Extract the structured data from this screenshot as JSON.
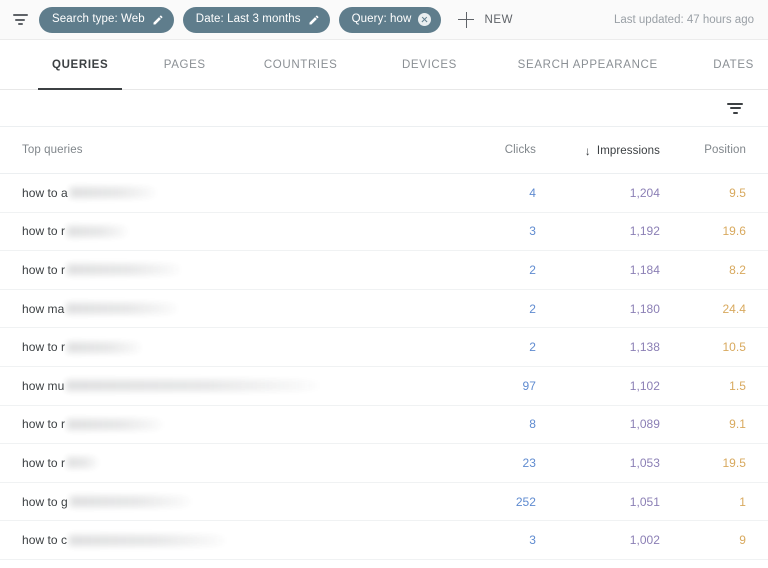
{
  "filter_bar": {
    "filter_icon": "filter-icon",
    "chips": [
      {
        "label": "Search type: Web",
        "action": "edit",
        "action_icon": "pencil-icon"
      },
      {
        "label": "Date: Last 3 months",
        "action": "edit",
        "action_icon": "pencil-icon"
      },
      {
        "label": "Query: how",
        "action": "clear",
        "action_icon": "close-circle-icon"
      }
    ],
    "new_button": {
      "label": "NEW",
      "icon": "plus-icon"
    },
    "last_updated": "Last updated: 47 hours ago",
    "chip_color": "#5f7d8c"
  },
  "tabs": [
    {
      "label": "QUERIES",
      "active": true
    },
    {
      "label": "PAGES",
      "active": false
    },
    {
      "label": "COUNTRIES",
      "active": false
    },
    {
      "label": "DEVICES",
      "active": false
    },
    {
      "label": "SEARCH APPEARANCE",
      "active": false
    },
    {
      "label": "DATES",
      "active": false
    }
  ],
  "table_toolbar": {
    "filter_icon": "filter-icon"
  },
  "table": {
    "columns": {
      "query": "Top queries",
      "clicks": "Clicks",
      "impressions": "Impressions",
      "position": "Position"
    },
    "sort": {
      "column": "Impressions",
      "direction": "descending",
      "arrow": "↓"
    },
    "value_colors": {
      "clicks": "#5f8bd0",
      "impressions": "#8b7fb5",
      "position": "#d8a95e"
    },
    "rows": [
      {
        "query_prefix": "how to a",
        "redacted_width": 88,
        "clicks": "4",
        "impressions": "1,204",
        "position": "9.5"
      },
      {
        "query_prefix": "how to r",
        "redacted_width": 62,
        "clicks": "3",
        "impressions": "1,192",
        "position": "19.6"
      },
      {
        "query_prefix": "how to r",
        "redacted_width": 116,
        "clicks": "2",
        "impressions": "1,184",
        "position": "8.2"
      },
      {
        "query_prefix": "how ma",
        "redacted_width": 114,
        "clicks": "2",
        "impressions": "1,180",
        "position": "24.4"
      },
      {
        "query_prefix": "how to r",
        "redacted_width": 76,
        "clicks": "2",
        "impressions": "1,138",
        "position": "10.5"
      },
      {
        "query_prefix": "how mu",
        "redacted_width": 258,
        "clicks": "97",
        "impressions": "1,102",
        "position": "1.5"
      },
      {
        "query_prefix": "how to r",
        "redacted_width": 98,
        "clicks": "8",
        "impressions": "1,089",
        "position": "9.1"
      },
      {
        "query_prefix": "how to r",
        "redacted_width": 32,
        "clicks": "23",
        "impressions": "1,053",
        "position": "19.5"
      },
      {
        "query_prefix": "how to g",
        "redacted_width": 124,
        "clicks": "252",
        "impressions": "1,051",
        "position": "1"
      },
      {
        "query_prefix": "how to c",
        "redacted_width": 160,
        "clicks": "3",
        "impressions": "1,002",
        "position": "9"
      }
    ]
  }
}
